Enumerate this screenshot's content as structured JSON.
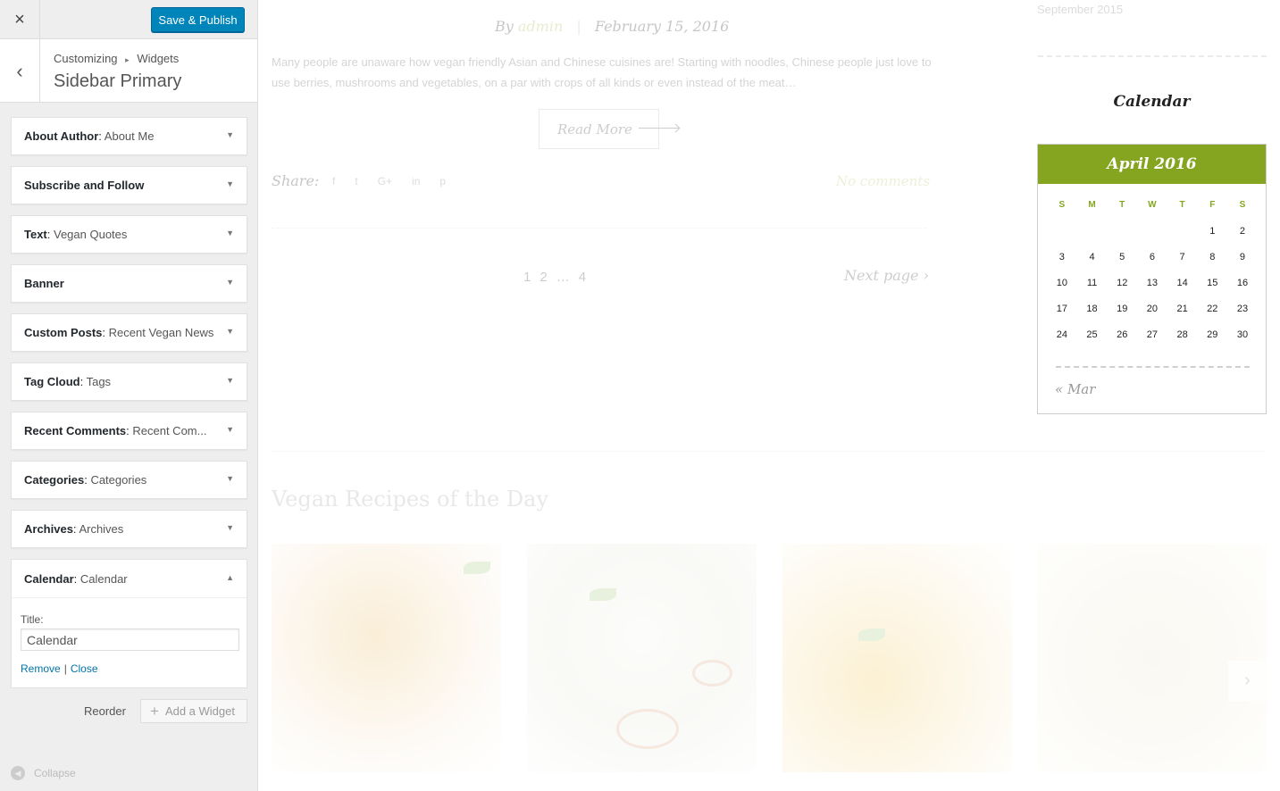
{
  "customizer": {
    "close_icon": "×",
    "save_label": "Save & Publish",
    "back_icon": "‹",
    "breadcrumb": {
      "root": "Customizing",
      "sep": "▸",
      "current": "Widgets"
    },
    "section_title": "Sidebar Primary",
    "widgets": [
      {
        "type": "About Author",
        "name": "About Me"
      },
      {
        "type": "Subscribe and Follow",
        "name": ""
      },
      {
        "type": "Text",
        "name": "Vegan Quotes"
      },
      {
        "type": "Banner",
        "name": ""
      },
      {
        "type": "Custom Posts",
        "name": "Recent Vegan News"
      },
      {
        "type": "Tag Cloud",
        "name": "Tags"
      },
      {
        "type": "Recent Comments",
        "name": "Recent Com..."
      },
      {
        "type": "Categories",
        "name": "Categories"
      },
      {
        "type": "Archives",
        "name": "Archives"
      }
    ],
    "open_widget": {
      "type": "Calendar",
      "name": "Calendar",
      "title_label": "Title:",
      "title_value": "Calendar",
      "remove_label": "Remove",
      "separator": "|",
      "close_label": "Close"
    },
    "reorder_label": "Reorder",
    "add_widget_label": "Add a Widget",
    "collapse_label": "Collapse",
    "accent_color": "#0085ba"
  },
  "preview": {
    "post": {
      "by": "By",
      "author": "admin",
      "date": "February 15, 2016",
      "excerpt": "Many people are unaware how vegan friendly Asian and Chinese cuisines are! Starting with noodles, Chinese people just love to use berries, mushrooms and vegetables, on a par with crops of all kinds or even instead of the meat…",
      "read_more": "Read More",
      "share_label": "Share:",
      "share_icons": [
        "f",
        "t",
        "G+",
        "in",
        "p"
      ],
      "comments": "No comments"
    },
    "pagination": {
      "pages": [
        "1",
        "2",
        "…",
        "4"
      ],
      "next": "Next page ›"
    },
    "sidebar": {
      "archive_item": "September 2015",
      "calendar_heading": "Calendar",
      "calendar": {
        "month": "April 2016",
        "weekdays": [
          "S",
          "M",
          "T",
          "W",
          "T",
          "F",
          "S"
        ],
        "weeks": [
          [
            "",
            "",
            "",
            "",
            "",
            "1",
            "2"
          ],
          [
            "3",
            "4",
            "5",
            "6",
            "7",
            "8",
            "9"
          ],
          [
            "10",
            "11",
            "12",
            "13",
            "14",
            "15",
            "16"
          ],
          [
            "17",
            "18",
            "19",
            "20",
            "21",
            "22",
            "23"
          ],
          [
            "24",
            "25",
            "26",
            "27",
            "28",
            "29",
            "30"
          ]
        ],
        "prev": "« Mar",
        "accent": "#85a521"
      }
    },
    "recipes_title": "Vegan Recipes of the Day",
    "carousel_next_icon": "›"
  }
}
